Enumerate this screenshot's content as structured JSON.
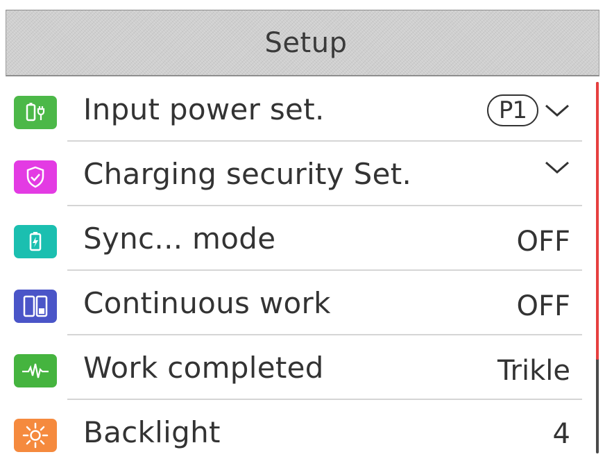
{
  "header": {
    "title": "Setup"
  },
  "menu": {
    "items": [
      {
        "label": "Input power set.",
        "value": "P1",
        "control": "chevron-down",
        "icon": "charger-plug-icon",
        "icon_color": "#4cb848"
      },
      {
        "label": "Charging security Set.",
        "value": "",
        "control": "chevron-down",
        "icon": "shield-check-icon",
        "icon_color": "#e33be3"
      },
      {
        "label": "Sync... mode",
        "value": "OFF",
        "icon": "battery-bolt-icon",
        "icon_color": "#1bbfb0"
      },
      {
        "label": "Continuous work",
        "value": "OFF",
        "icon": "dual-battery-icon",
        "icon_color": "#4a55c8"
      },
      {
        "label": "Work completed",
        "value": "Trikle",
        "icon": "pulse-wave-icon",
        "icon_color": "#45b43f"
      },
      {
        "label": "Backlight",
        "value": "4",
        "icon": "sun-icon",
        "icon_color": "#f58a3e"
      }
    ]
  },
  "colors": {
    "scroll_thumb": "#e63f3f",
    "scroll_track": "#4a4a4a",
    "header_bg": "#cfcfcf"
  }
}
